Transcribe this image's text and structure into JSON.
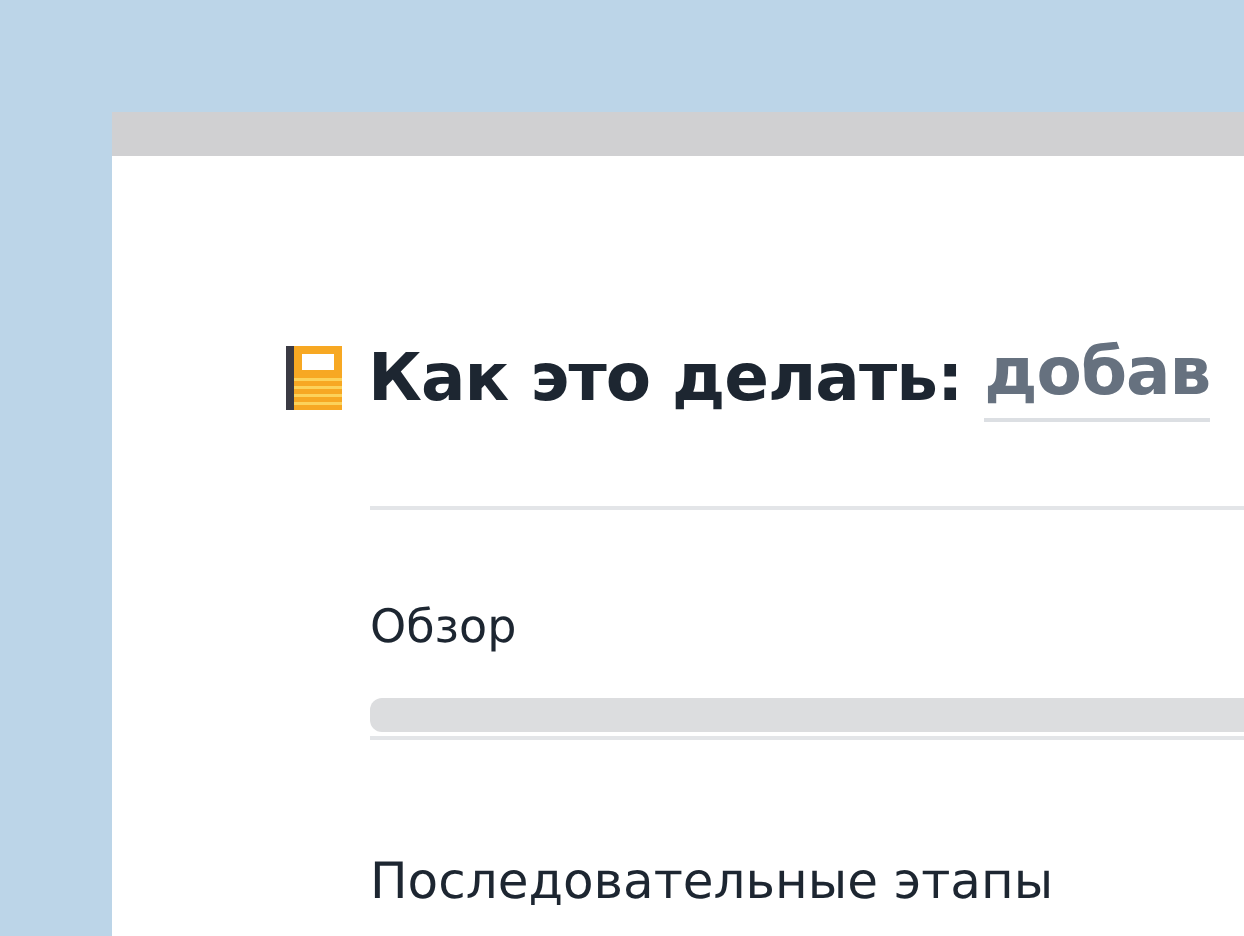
{
  "title": {
    "prefix": "Как это делать:",
    "subject": "добав"
  },
  "sections": [
    {
      "heading": "Обзор"
    },
    {
      "heading": "Последовательные этапы"
    }
  ]
}
